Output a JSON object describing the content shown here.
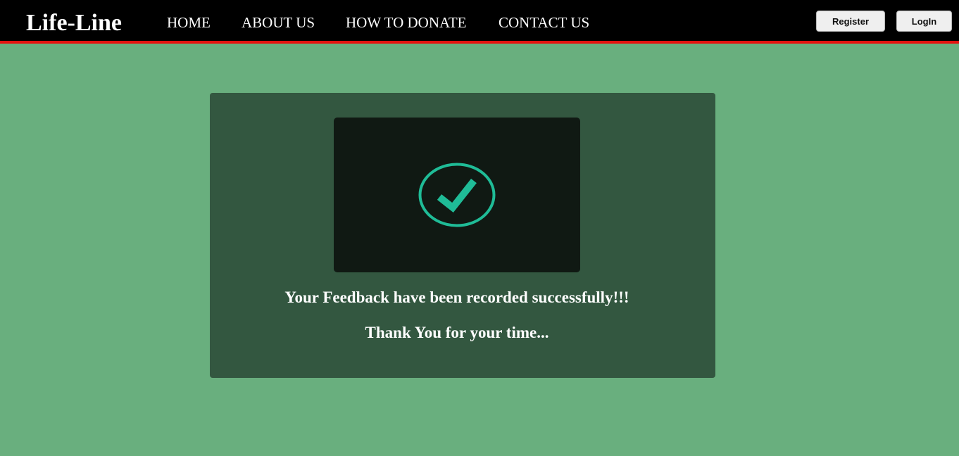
{
  "header": {
    "brand": "Life-Line",
    "nav": [
      {
        "label": "HOME"
      },
      {
        "label": "ABOUT US"
      },
      {
        "label": "HOW TO DONATE"
      },
      {
        "label": "CONTACT US"
      }
    ],
    "register_label": "Register",
    "login_label": "LogIn"
  },
  "confirmation": {
    "icon": "checkmark-circle-icon",
    "message": "Your Feedback have been recorded successfully!!!",
    "thanks": "Thank You for your time..."
  },
  "colors": {
    "page_background": "#69af7e",
    "navbar_background": "#000000",
    "navbar_accent": "#e4130f",
    "card_background": "#335740",
    "icon_box_background": "#101913",
    "check_color": "#1fbc97"
  }
}
